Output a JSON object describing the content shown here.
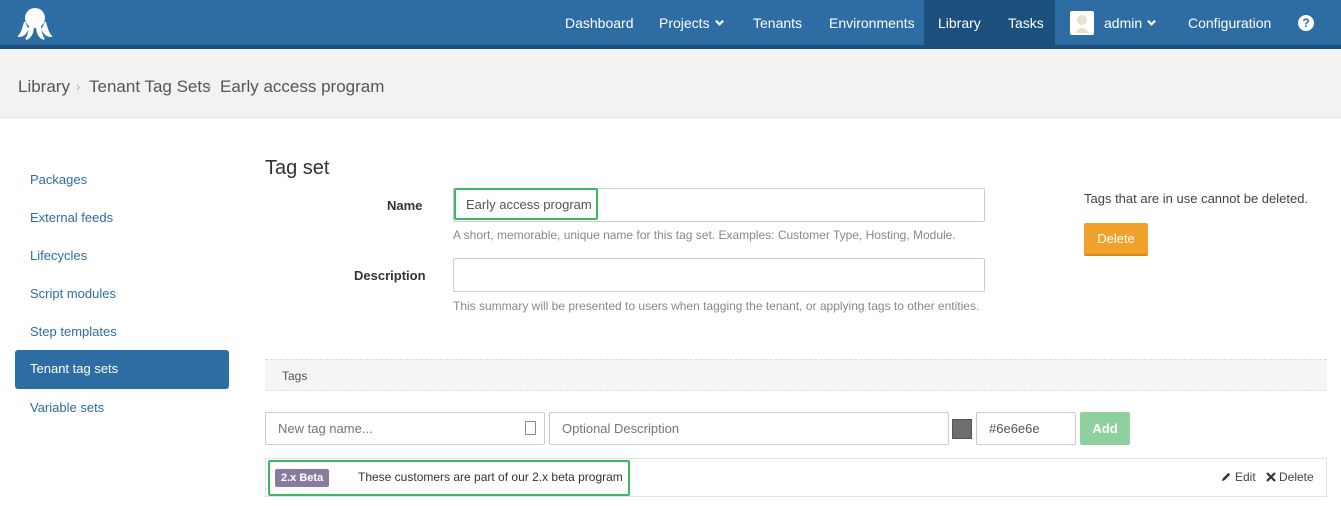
{
  "nav": {
    "items": [
      "Dashboard",
      "Projects",
      "Tenants",
      "Environments",
      "Library",
      "Tasks"
    ],
    "user": "admin",
    "configuration": "Configuration",
    "help": "?"
  },
  "breadcrumb": [
    "Library",
    "Tenant Tag Sets",
    "Early access program"
  ],
  "sidebar": {
    "items": [
      "Packages",
      "External feeds",
      "Lifecycles",
      "Script modules",
      "Step templates",
      "Tenant tag sets",
      "Variable sets"
    ],
    "active": "Tenant tag sets"
  },
  "form": {
    "title": "Tag set",
    "name_label": "Name",
    "name_value": "Early access program",
    "name_help": "A short, memorable, unique name for this tag set. Examples: Customer Type, Hosting, Module.",
    "description_label": "Description",
    "description_value": "",
    "description_help": "This summary will be presented to users when tagging the tenant, or applying tags to other entities.",
    "delete_note": "Tags that are in use cannot be deleted.",
    "delete_button": "Delete"
  },
  "tags": {
    "header": "Tags",
    "new_name_placeholder": "New tag name...",
    "description_placeholder": "Optional Description",
    "color_value": "#6e6e6e",
    "add_button": "Add",
    "rows": [
      {
        "name": "2.x Beta",
        "color": "#8a7a9e",
        "description": "These customers are part of our 2.x beta program",
        "edit": "Edit",
        "delete": "Delete"
      }
    ]
  },
  "colors": {
    "nav": "#2e6da4",
    "nav_active": "#1b4f7e",
    "delete": "#f0a12a",
    "add": "#8fd19e",
    "highlight": "#3cb862"
  }
}
